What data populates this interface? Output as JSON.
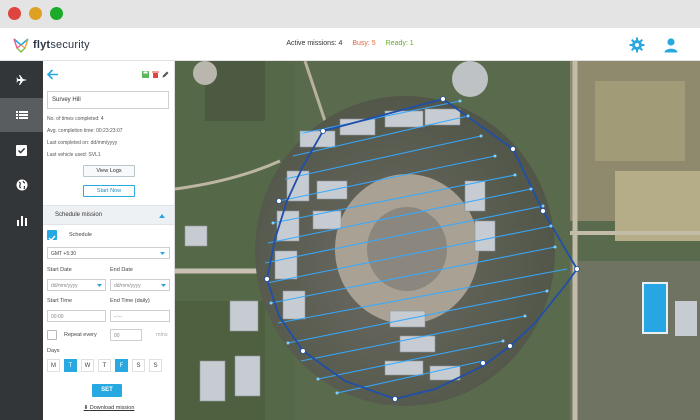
{
  "window": {
    "traffic_lights": [
      "#e0443e",
      "#dea123",
      "#1aab29"
    ]
  },
  "header": {
    "brand_prefix": "flyt",
    "brand_suffix": "security",
    "active_missions_label": "Active missions: 4",
    "busy_label": "Busy: 5",
    "ready_label": "Ready: 1",
    "settings_icon": "gear-icon",
    "profile_icon": "user-icon",
    "colors": {
      "busy": "#e0653a",
      "ready": "#6aaa2a",
      "accent": "#27a8e0"
    }
  },
  "rail": {
    "items": [
      {
        "name": "rail-item-flights",
        "icon": "plane-icon",
        "active": false
      },
      {
        "name": "rail-item-missions",
        "icon": "list-icon",
        "active": true
      },
      {
        "name": "rail-item-tasks",
        "icon": "checkbox-icon",
        "active": false
      },
      {
        "name": "rail-item-globe",
        "icon": "globe-icon",
        "active": false
      },
      {
        "name": "rail-item-analytics",
        "icon": "bar-chart-icon",
        "active": false
      }
    ]
  },
  "mission": {
    "name": "Survey Hill",
    "info": [
      "No. of times completed: 4",
      "Avg. completion time: 00:23:23:07",
      "Last completed on: dd/mm/yyyy",
      "Last vehicle used: SVL1"
    ],
    "view_logs_label": "View Logs",
    "start_now_label": "Start Now"
  },
  "schedule": {
    "section_label": "Schedule mission",
    "checkbox_label": "Schedule",
    "timezone": "GMT +5:30",
    "start_date_label": "Start Date",
    "start_date_value": "dd/mm/yyyy",
    "end_date_label": "End Date",
    "end_date_value": "dd/mm/yyyy",
    "start_time_label": "Start Time",
    "start_time_value": "00:00",
    "end_time_label": "End Time (daily)",
    "end_time_value": "--:--",
    "repeat_label": "Repeat every",
    "repeat_value": "00",
    "repeat_unit": "mins",
    "days_label": "Days",
    "days": [
      {
        "label": "M",
        "on": false
      },
      {
        "label": "T",
        "on": true
      },
      {
        "label": "W",
        "on": false
      },
      {
        "label": "T",
        "on": false
      },
      {
        "label": "F",
        "on": true
      },
      {
        "label": "S",
        "on": false
      },
      {
        "label": "S",
        "on": false
      }
    ],
    "set_label": "SET",
    "download_label": "Download mission"
  }
}
